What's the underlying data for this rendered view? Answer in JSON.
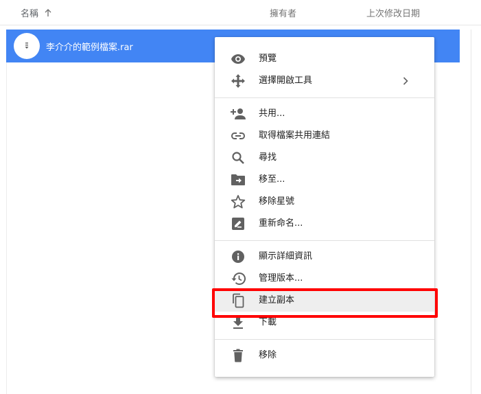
{
  "header": {
    "name_label": "名稱",
    "owner_label": "擁有者",
    "modified_label": "上次修改日期"
  },
  "file": {
    "name": "李介介的範例檔案.rar",
    "icon": "archive-icon"
  },
  "context_menu": {
    "items": [
      {
        "label": "預覽",
        "icon": "eye-icon"
      },
      {
        "label": "選擇開啟工具",
        "icon": "move-arrows-icon",
        "has_submenu": true
      },
      {
        "label": "共用...",
        "icon": "person-add-icon"
      },
      {
        "label": "取得檔案共用連結",
        "icon": "link-icon"
      },
      {
        "label": "尋找",
        "icon": "search-icon"
      },
      {
        "label": "移至...",
        "icon": "folder-move-icon"
      },
      {
        "label": "移除星號",
        "icon": "star-outline-icon"
      },
      {
        "label": "重新命名...",
        "icon": "rename-icon"
      },
      {
        "label": "顯示詳細資訊",
        "icon": "info-icon"
      },
      {
        "label": "管理版本...",
        "icon": "history-icon"
      },
      {
        "label": "建立副本",
        "icon": "copy-icon",
        "highlighted": true
      },
      {
        "label": "下載",
        "icon": "download-icon"
      },
      {
        "label": "移除",
        "icon": "trash-icon"
      }
    ]
  },
  "colors": {
    "selection": "#4285f4",
    "highlight_box": "#ff0000",
    "icon": "#616161"
  }
}
